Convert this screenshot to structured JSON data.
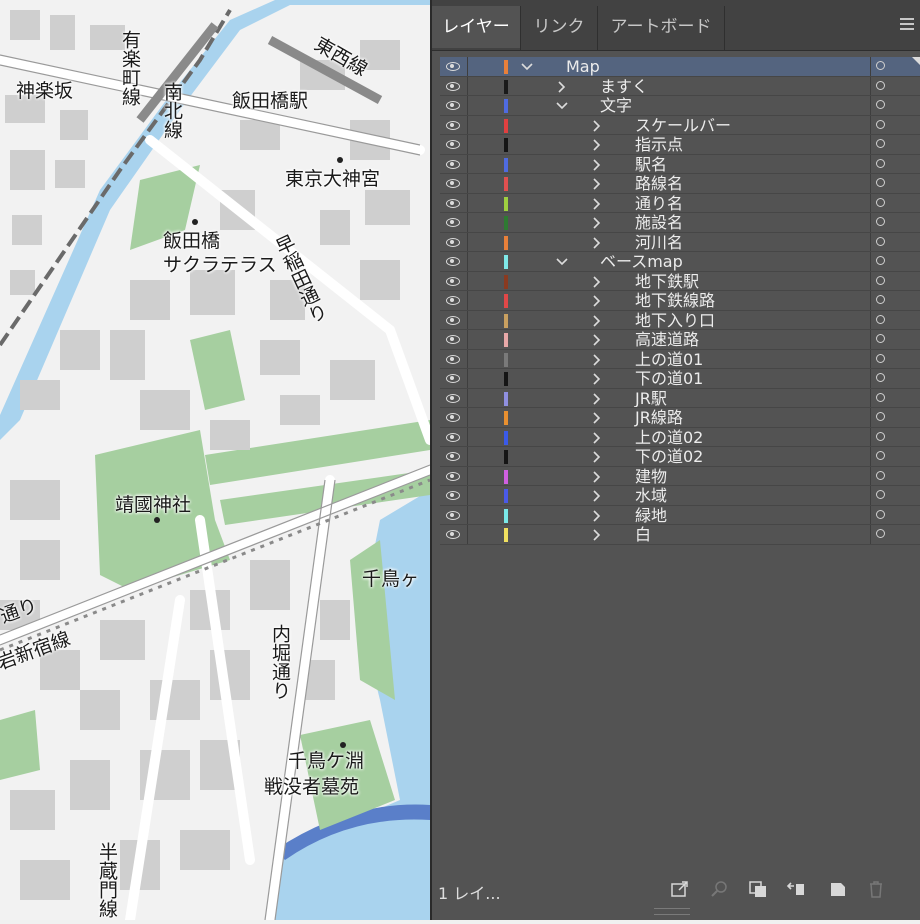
{
  "map": {
    "labels": {
      "kagurazaka": "神楽坂",
      "yurakucho": "有楽町線",
      "nanboku": "南北線",
      "tozai": "東西線",
      "iidabashi_station": "飯田橋駅",
      "tokyo_daijingu": "東京大神宮",
      "iidabashi": "飯田橋",
      "sakura_terrace": "サクラテラス",
      "waseda_dori": "早稲田通り",
      "yasukuni": "靖國神社",
      "chidori_short": "千鳥ヶ",
      "dori_partial": "通り",
      "shinjuku_line": "岩新宿線",
      "uchibori": "内堀通り",
      "chidorigafuchi": "千鳥ケ淵",
      "senbotsusha": "戦没者墓苑",
      "hanzomon": "半蔵門線"
    }
  },
  "panel": {
    "tabs": [
      {
        "label": "レイヤー",
        "active": true
      },
      {
        "label": "リンク",
        "active": false
      },
      {
        "label": "アートボード",
        "active": false
      }
    ],
    "layers": [
      {
        "name": "Map",
        "color": "#e8803a",
        "depth": 0,
        "expanded": true,
        "selected": true
      },
      {
        "name": "ますく",
        "color": "#1a1a1a",
        "depth": 1,
        "expanded": false
      },
      {
        "name": "文字",
        "color": "#4f6be0",
        "depth": 1,
        "expanded": true
      },
      {
        "name": "スケールバー",
        "color": "#e04040",
        "depth": 2,
        "expanded": false
      },
      {
        "name": "指示点",
        "color": "#151515",
        "depth": 2,
        "expanded": false
      },
      {
        "name": "駅名",
        "color": "#4f6be0",
        "depth": 2,
        "expanded": false
      },
      {
        "name": "路線名",
        "color": "#e05050",
        "depth": 2,
        "expanded": false
      },
      {
        "name": "通り名",
        "color": "#9ed040",
        "depth": 2,
        "expanded": false
      },
      {
        "name": "施設名",
        "color": "#2e7a32",
        "depth": 2,
        "expanded": false
      },
      {
        "name": "河川名",
        "color": "#e8803a",
        "depth": 2,
        "expanded": false
      },
      {
        "name": "ベースmap",
        "color": "#7fe8e8",
        "depth": 1,
        "expanded": true
      },
      {
        "name": "地下鉄駅",
        "color": "#8a3a20",
        "depth": 2,
        "expanded": false
      },
      {
        "name": "地下鉄線路",
        "color": "#e04848",
        "depth": 2,
        "expanded": false
      },
      {
        "name": "地下入り口",
        "color": "#c9a060",
        "depth": 2,
        "expanded": false
      },
      {
        "name": "高速道路",
        "color": "#e8a8a8",
        "depth": 2,
        "expanded": false
      },
      {
        "name": "上の道01",
        "color": "#7a7a7a",
        "depth": 2,
        "expanded": false
      },
      {
        "name": "下の道01",
        "color": "#151515",
        "depth": 2,
        "expanded": false
      },
      {
        "name": "JR駅",
        "color": "#9090e0",
        "depth": 2,
        "expanded": false
      },
      {
        "name": "JR線路",
        "color": "#e89030",
        "depth": 2,
        "expanded": false
      },
      {
        "name": "上の道02",
        "color": "#3a5ae8",
        "depth": 2,
        "expanded": false
      },
      {
        "name": "下の道02",
        "color": "#151515",
        "depth": 2,
        "expanded": false
      },
      {
        "name": "建物",
        "color": "#d060e0",
        "depth": 2,
        "expanded": false
      },
      {
        "name": "水域",
        "color": "#4a5ae8",
        "depth": 2,
        "expanded": false
      },
      {
        "name": "緑地",
        "color": "#7ae8e8",
        "depth": 2,
        "expanded": false
      },
      {
        "name": "白",
        "color": "#f0e060",
        "depth": 2,
        "expanded": false
      }
    ],
    "footer": {
      "layer_count": "1 レイ..."
    },
    "icons": [
      "eye-icon",
      "target-icon",
      "chevron-icon",
      "export-icon",
      "search-icon",
      "clipping-mask-icon",
      "move-to-layer-icon",
      "new-layer-icon",
      "trash-icon",
      "panel-menu-icon"
    ]
  }
}
